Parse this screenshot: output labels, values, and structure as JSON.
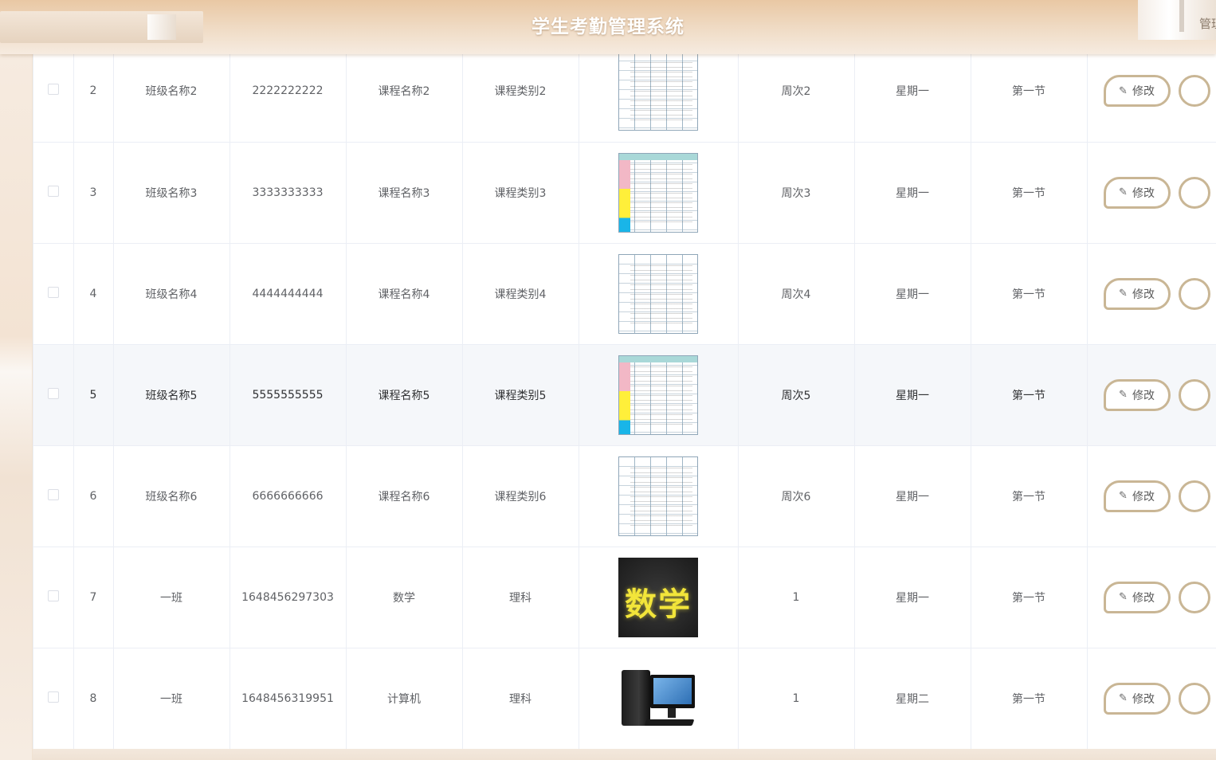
{
  "header": {
    "title": "学生考勤管理系统",
    "user_label": "管理员"
  },
  "table": {
    "edit_label": "修改",
    "rows": [
      {
        "index": "2",
        "class_name": "班级名称2",
        "course_no": "2222222222",
        "course_name": "课程名称2",
        "course_type": "课程类别2",
        "image": "schedule-plain",
        "week": "周次2",
        "weekday": "星期一",
        "period": "第一节"
      },
      {
        "index": "3",
        "class_name": "班级名称3",
        "course_no": "3333333333",
        "course_name": "课程名称3",
        "course_type": "课程类别3",
        "image": "schedule-color",
        "week": "周次3",
        "weekday": "星期一",
        "period": "第一节"
      },
      {
        "index": "4",
        "class_name": "班级名称4",
        "course_no": "4444444444",
        "course_name": "课程名称4",
        "course_type": "课程类别4",
        "image": "schedule-plain",
        "week": "周次4",
        "weekday": "星期一",
        "period": "第一节"
      },
      {
        "index": "5",
        "class_name": "班级名称5",
        "course_no": "5555555555",
        "course_name": "课程名称5",
        "course_type": "课程类别5",
        "image": "schedule-color",
        "week": "周次5",
        "weekday": "星期一",
        "period": "第一节"
      },
      {
        "index": "6",
        "class_name": "班级名称6",
        "course_no": "6666666666",
        "course_name": "课程名称6",
        "course_type": "课程类别6",
        "image": "schedule-plain",
        "week": "周次6",
        "weekday": "星期一",
        "period": "第一节"
      },
      {
        "index": "7",
        "class_name": "一班",
        "course_no": "1648456297303",
        "course_name": "数学",
        "course_type": "理科",
        "image": "math",
        "image_text": "数学",
        "week": "1",
        "weekday": "星期一",
        "period": "第一节"
      },
      {
        "index": "8",
        "class_name": "一班",
        "course_no": "1648456319951",
        "course_name": "计算机",
        "course_type": "理科",
        "image": "computer",
        "week": "1",
        "weekday": "星期二",
        "period": "第一节"
      }
    ]
  },
  "colors": {
    "accent_border": "#c9b695",
    "header_gradient_top": "#e9c8a4",
    "row_hover": "#f5f7fa"
  }
}
